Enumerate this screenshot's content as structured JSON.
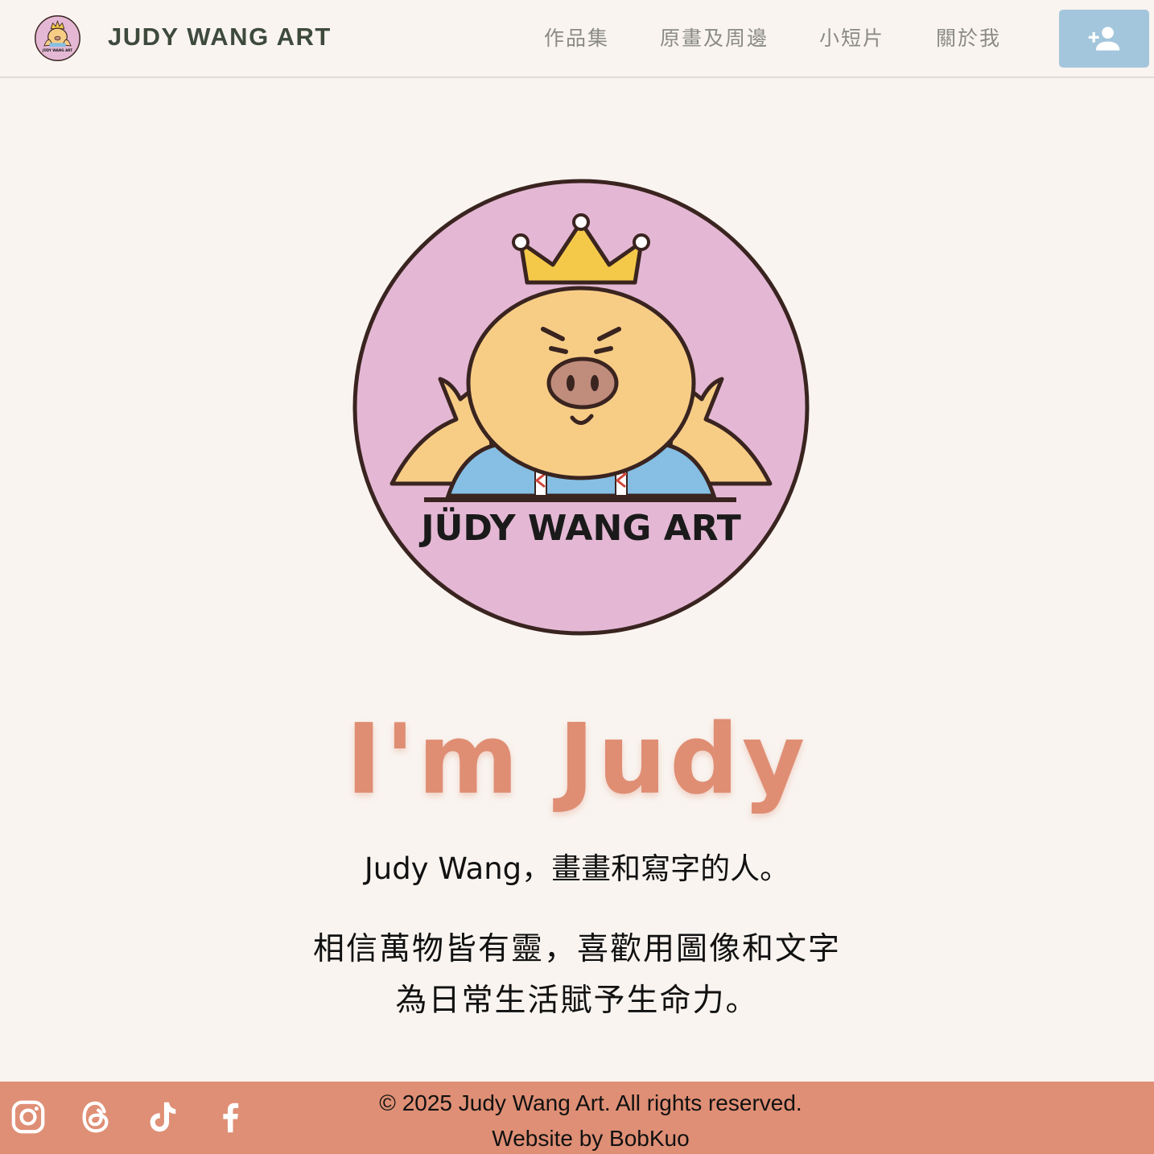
{
  "header": {
    "site_title": "JUDY WANG ART",
    "nav": [
      {
        "label": "作品集"
      },
      {
        "label": "原畫及周邊"
      },
      {
        "label": "小短片"
      },
      {
        "label": "關於我"
      }
    ],
    "signup_icon": "person-add-icon"
  },
  "hero": {
    "logo_text": "JÜDY WANG ART",
    "heading": "I'm Judy",
    "subtitle": "Judy Wang，畫畫和寫字的人。",
    "description_lines": [
      "相信萬物皆有靈，喜歡用圖像和文字",
      "為日常生活賦予生命力。"
    ]
  },
  "footer": {
    "social": [
      "instagram-icon",
      "threads-icon",
      "tiktok-icon",
      "facebook-icon"
    ],
    "copyright": "© 2025 Judy Wang Art. All rights reserved.",
    "credit": "Website by BobKuo"
  },
  "colors": {
    "background": "#f9f4f0",
    "title": "#3e4a3c",
    "nav_text": "#8a8a86",
    "signup_button": "#a3c6dc",
    "heading": "#df8e74",
    "footer": "#df8f75",
    "logo_circle": "#e4b8d4",
    "mascot": "#f7cd86",
    "crown": "#f4c94a",
    "shirt": "#86bfe3"
  }
}
